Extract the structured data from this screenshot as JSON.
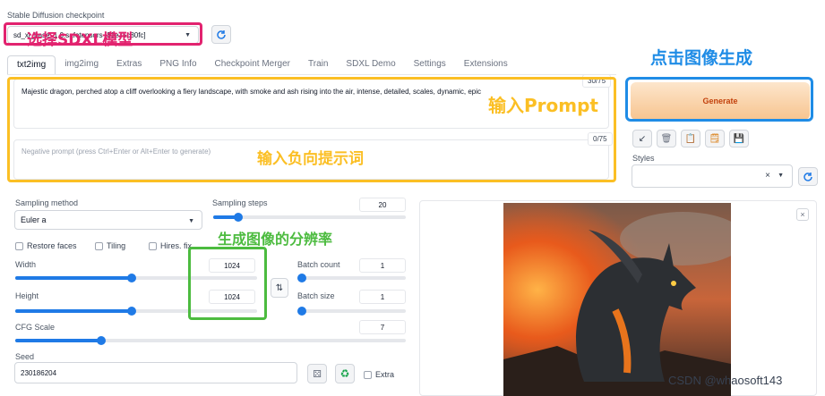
{
  "checkpoint": {
    "label": "Stable Diffusion checkpoint",
    "value": "sd_xl_base_1.0.safetensors [31e35c80fc]",
    "annotation": "选择SDXL模型"
  },
  "tabs": [
    "txt2img",
    "img2img",
    "Extras",
    "PNG Info",
    "Checkpoint Merger",
    "Train",
    "SDXL Demo",
    "Settings",
    "Extensions"
  ],
  "prompt": {
    "value": "Majestic dragon, perched atop a cliff overlooking a fiery landscape, with smoke and ash rising into the air, intense, detailed, scales, dynamic, epic",
    "counter": "30/75",
    "annotation": "输入Prompt"
  },
  "negative_prompt": {
    "placeholder": "Negative prompt (press Ctrl+Enter or Alt+Enter to generate)",
    "counter": "0/75",
    "annotation": "输入负向提示词"
  },
  "generate": {
    "label": "Generate",
    "annotation": "点击图像生成"
  },
  "styles": {
    "label": "Styles",
    "clear": "×"
  },
  "sampling": {
    "method_label": "Sampling method",
    "method_value": "Euler a",
    "steps_label": "Sampling steps",
    "steps_value": "20",
    "steps_fraction": 0.13
  },
  "checkboxes": {
    "restore_faces": "Restore faces",
    "tiling": "Tiling",
    "hires_fix": "Hires. fix"
  },
  "resolution_annotation": "生成图像的分辨率",
  "width": {
    "label": "Width",
    "value": "1024",
    "fraction": 0.48
  },
  "height": {
    "label": "Height",
    "value": "1024",
    "fraction": 0.48
  },
  "batch_count": {
    "label": "Batch count",
    "value": "1"
  },
  "batch_size": {
    "label": "Batch size",
    "value": "1"
  },
  "cfg": {
    "label": "CFG Scale",
    "value": "7",
    "fraction": 0.22
  },
  "seed": {
    "label": "Seed",
    "value": "230186204",
    "extra_label": "Extra"
  },
  "watermark": "CSDN @whaosoft143",
  "colors": {
    "accent": "#1f7ae6",
    "generate": "#f7c48f",
    "annotation_yellow": "#fbbf24",
    "annotation_pink": "#e2236f",
    "annotation_blue": "#1f8ce6",
    "annotation_green": "#4cbb3f"
  }
}
